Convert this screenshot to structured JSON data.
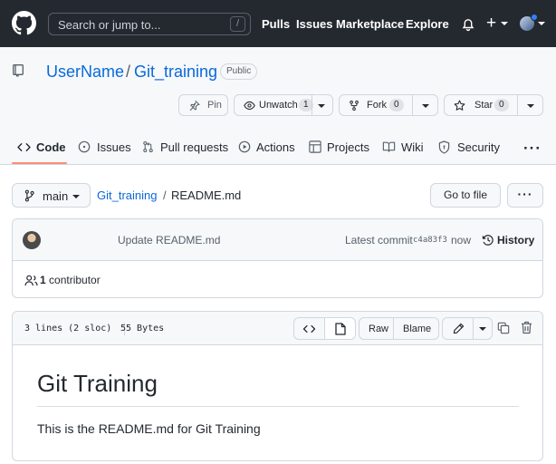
{
  "header": {
    "search_placeholder": "Search or jump to...",
    "search_shortcut": "/",
    "nav": [
      "Pulls",
      "Issues",
      "Marketplace",
      "Explore"
    ]
  },
  "repo": {
    "owner": "UserName",
    "separator": "/",
    "name": "Git_training",
    "visibility": "Public",
    "actions": {
      "pin_label": "Pin",
      "watch_label": "Unwatch",
      "watch_count": "1",
      "fork_label": "Fork",
      "fork_count": "0",
      "star_label": "Star",
      "star_count": "0"
    },
    "tabs": [
      {
        "label": "Code",
        "icon": "code-icon",
        "selected": true
      },
      {
        "label": "Issues",
        "icon": "issue-icon"
      },
      {
        "label": "Pull requests",
        "icon": "pull-request-icon"
      },
      {
        "label": "Actions",
        "icon": "play-icon"
      },
      {
        "label": "Projects",
        "icon": "table-icon"
      },
      {
        "label": "Wiki",
        "icon": "book-icon"
      },
      {
        "label": "Security",
        "icon": "shield-icon"
      }
    ],
    "more": "···"
  },
  "filenav": {
    "branch": "main",
    "crumb_repo": "Git_training",
    "crumb_sep": "/",
    "crumb_file": "README.md",
    "goto_file": "Go to file",
    "more": "···"
  },
  "commit": {
    "message": "Update README.md",
    "latest_label": "Latest commit",
    "sha": "c4a83f3",
    "time": "now",
    "history": "History",
    "contributors_count": "1",
    "contributors_label": "contributor"
  },
  "file": {
    "lines": "3 lines (2 sloc)",
    "size": "55 Bytes",
    "raw": "Raw",
    "blame": "Blame",
    "content_title": "Git Training",
    "content_paragraph": "This is the README.md for Git Training"
  },
  "colors": {
    "header_bg": "#24292f",
    "link": "#0969da",
    "tab_underline": "#fd8c73",
    "border": "#d0d7de",
    "subtle_bg": "#f6f8fa"
  }
}
